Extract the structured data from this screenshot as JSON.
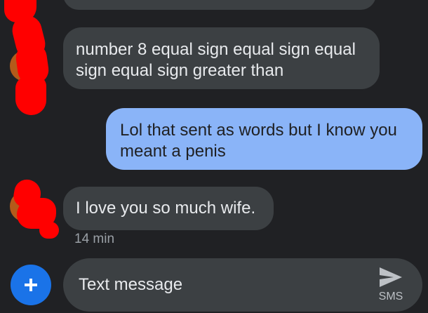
{
  "conversation": {
    "messages": [
      {
        "direction": "incoming",
        "text": ""
      },
      {
        "direction": "incoming",
        "text": "number 8 equal sign equal sign equal sign equal sign greater than"
      },
      {
        "direction": "outgoing",
        "text": "Lol that sent as words but I know you meant a penis"
      },
      {
        "direction": "incoming",
        "text": "I love you so much wife."
      }
    ],
    "last_timestamp": "14 min"
  },
  "composer": {
    "placeholder": "Text message",
    "send_mode_label": "SMS",
    "add_icon": "plus-icon",
    "send_icon": "send-icon"
  },
  "colors": {
    "background": "#202124",
    "incoming_bubble": "#3c4043",
    "outgoing_bubble": "#8ab4f8",
    "add_button": "#1a73e8",
    "redaction": "#ff0000"
  }
}
